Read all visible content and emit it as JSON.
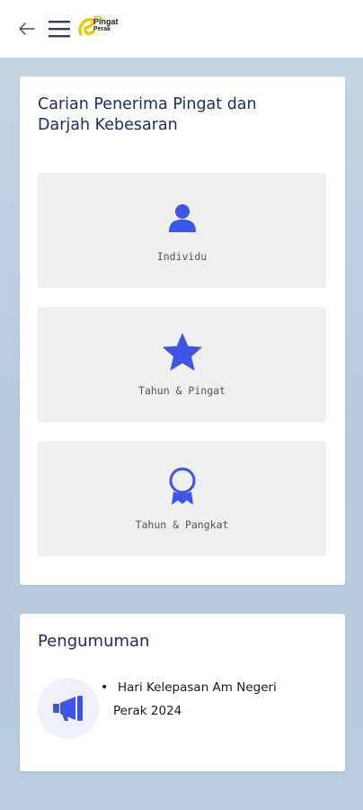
{
  "header": {
    "logo_line1": "Pingat",
    "logo_line2": "Perak",
    "logo_letter": "e"
  },
  "search": {
    "title": "Carian Penerima Pingat dan Darjah Kebesaran",
    "options": [
      {
        "label": "Individu",
        "icon": "person-icon"
      },
      {
        "label": "Tahun & Pingat",
        "icon": "star-icon"
      },
      {
        "label": "Tahun & Pangkat",
        "icon": "award-icon"
      }
    ]
  },
  "announcements": {
    "title": "Pengumuman",
    "icon": "megaphone-icon",
    "items": [
      {
        "text": "Hari Kelepasan Am Negeri Perak 2024"
      }
    ]
  },
  "colors": {
    "accent": "#3d55e6",
    "title": "#1d2a6b",
    "logo_yellow": "#f2c300"
  }
}
